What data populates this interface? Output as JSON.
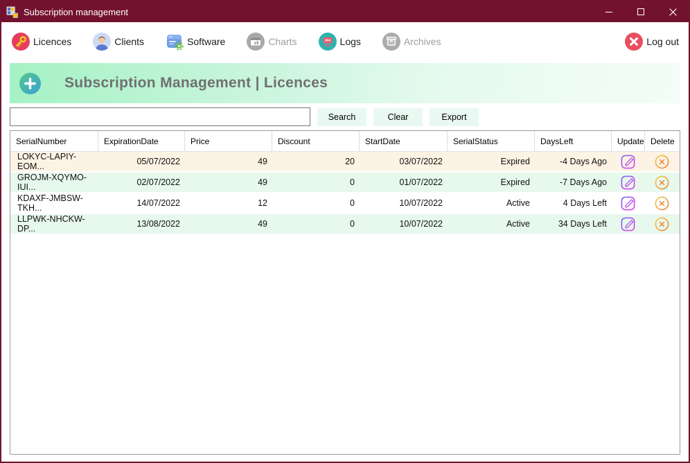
{
  "window": {
    "title": "Subscription management"
  },
  "toolbar": {
    "items": [
      {
        "label": "Licences",
        "enabled": true
      },
      {
        "label": "Clients",
        "enabled": true
      },
      {
        "label": "Software",
        "enabled": true
      },
      {
        "label": "Charts",
        "enabled": false
      },
      {
        "label": "Logs",
        "enabled": true
      },
      {
        "label": "Archives",
        "enabled": false
      }
    ],
    "logs_icon_text": "404",
    "logout_label": "Log out"
  },
  "banner": {
    "title": "Subscription Management | Licences"
  },
  "search": {
    "value": "",
    "search_label": "Search",
    "clear_label": "Clear",
    "export_label": "Export"
  },
  "table": {
    "columns": [
      "SerialNumber",
      "ExpirationDate",
      "Price",
      "Discount",
      "StartDate",
      "SerialStatus",
      "DaysLeft",
      "Update",
      "Delete"
    ],
    "rows": [
      {
        "serial": "LOKYC-LAPIY-EOM...",
        "expiration": "05/07/2022",
        "price": "49",
        "discount": "20",
        "start": "03/07/2022",
        "status": "Expired",
        "days_left": "-4 Days Ago"
      },
      {
        "serial": "GROJM-XQYMO-IUI...",
        "expiration": "02/07/2022",
        "price": "49",
        "discount": "0",
        "start": "01/07/2022",
        "status": "Expired",
        "days_left": "-7 Days Ago"
      },
      {
        "serial": "KDAXF-JMBSW-TKH...",
        "expiration": "14/07/2022",
        "price": "12",
        "discount": "0",
        "start": "10/07/2022",
        "status": "Active",
        "days_left": "4 Days Left"
      },
      {
        "serial": "LLPWK-NHCKW-DP...",
        "expiration": "13/08/2022",
        "price": "49",
        "discount": "0",
        "start": "10/07/2022",
        "status": "Active",
        "days_left": "34 Days Left"
      }
    ]
  },
  "colors": {
    "titlebar": "#73122f",
    "banner_green": "#a5f2c4",
    "row_highlight": "#fdf3e4",
    "row_alt": "#e7f8ed",
    "button_bg": "#e9f9f2",
    "logout_red": "#e94f5f",
    "update_gradient": [
      "#7b68f2",
      "#ee3cf0"
    ],
    "delete_gradient": [
      "#f4cf4e",
      "#ef7e34"
    ]
  }
}
